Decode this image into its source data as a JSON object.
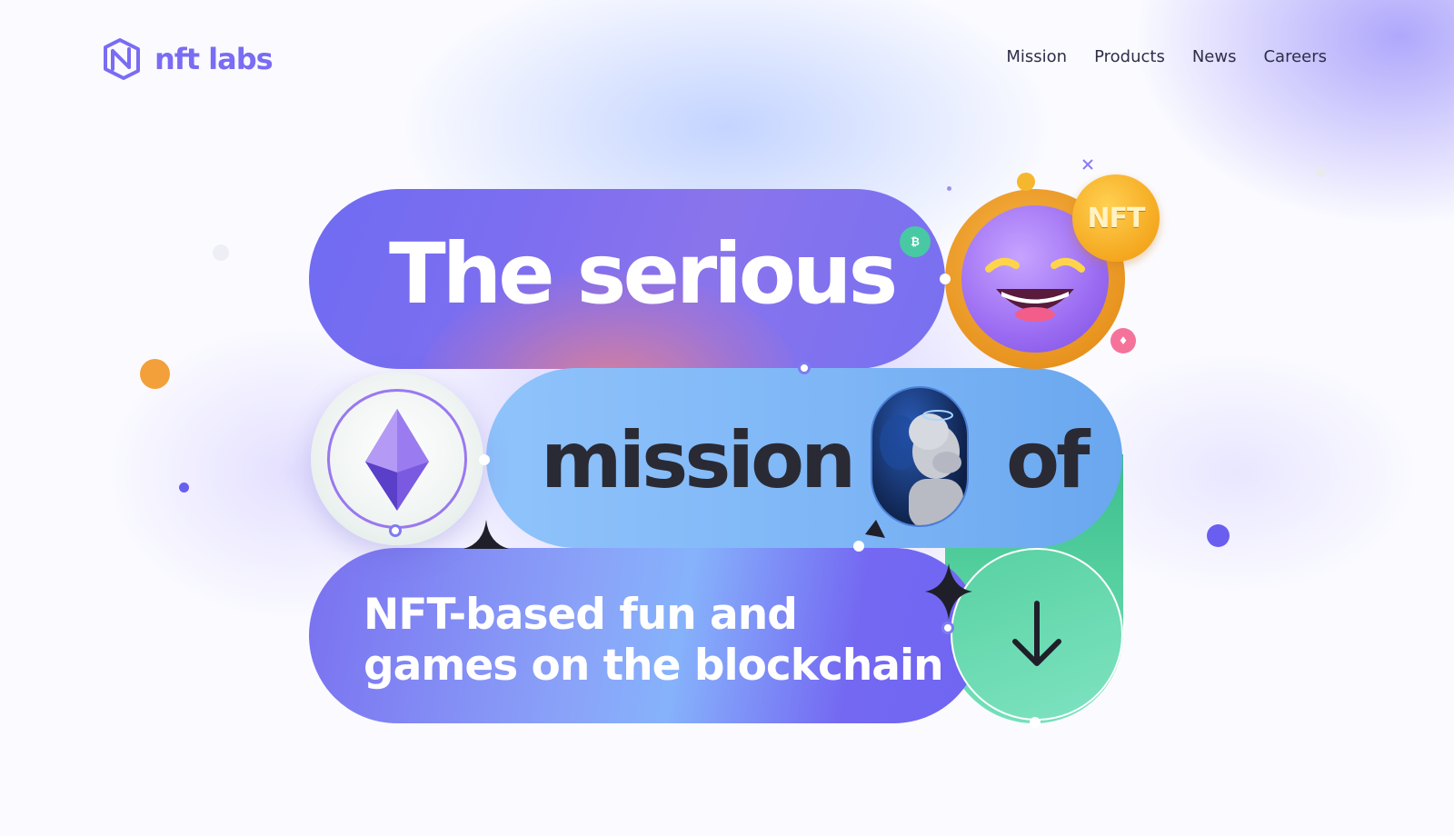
{
  "brand": {
    "name": "nft labs",
    "color": "#7a6cf3"
  },
  "nav": {
    "items": [
      {
        "label": "Mission"
      },
      {
        "label": "Products"
      },
      {
        "label": "News"
      },
      {
        "label": "Careers"
      }
    ]
  },
  "hero": {
    "line1": "The serious",
    "line2a": "mission",
    "line2b": "of",
    "line3a": "NFT-based fun and",
    "line3b": "games on the blockchain",
    "nft_coin_label": "NFT",
    "scroll_icon": "arrow-down-icon"
  },
  "colors": {
    "accent_purple": "#6f6cf2",
    "accent_blue": "#8fc3fb",
    "accent_green": "#54cf9e",
    "accent_orange": "#f4a51c"
  }
}
